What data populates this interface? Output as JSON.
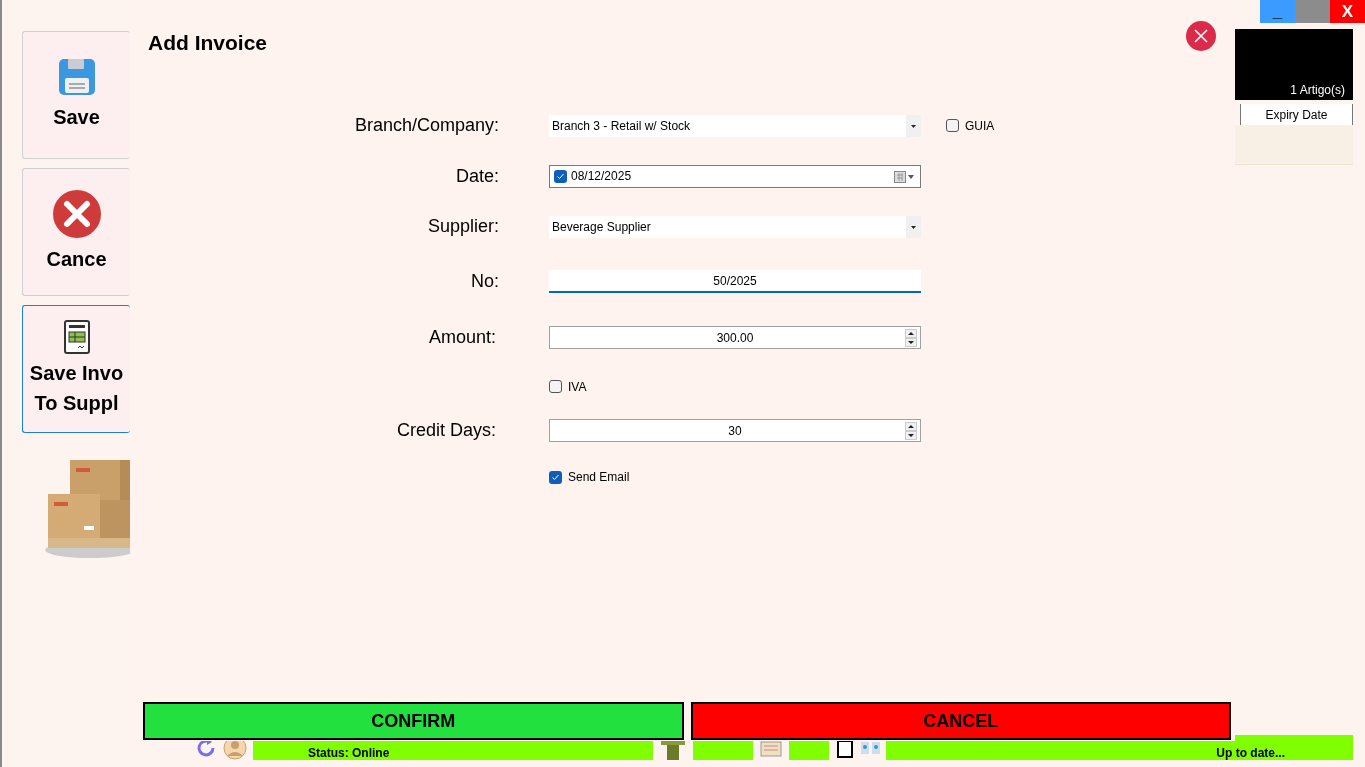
{
  "window_controls": [
    {
      "kind": "minimize",
      "label": "_"
    },
    {
      "kind": "maximize"
    },
    {
      "kind": "close",
      "label": "X"
    }
  ],
  "sidebar": {
    "buttons": [
      {
        "kind": "save",
        "lines": [
          "Save"
        ],
        "selected": false
      },
      {
        "kind": "cancel",
        "lines": [
          "Cance"
        ],
        "selected": false
      },
      {
        "kind": "invoice",
        "lines": [
          "Save Invo",
          "To Suppl"
        ],
        "selected": true
      }
    ]
  },
  "right_panel": {
    "summary": "1 Artigo(s)",
    "table": {
      "columns": [
        "Expiry Date"
      ]
    }
  },
  "dialog": {
    "title": "Add Invoice",
    "fields": [
      {
        "kind": "dropdown",
        "label": "Branch/Company:",
        "value": "Branch 3 - Retail w/ Stock",
        "side_checkbox": {
          "label": "GUIA",
          "checked": false
        }
      },
      {
        "kind": "date",
        "label": "Date:",
        "value": "08/12/2025",
        "checked": true
      },
      {
        "kind": "dropdown",
        "label": "Supplier:",
        "value": "Beverage Supplier"
      },
      {
        "kind": "text",
        "label": "No:",
        "value": "50/2025",
        "focused": true
      },
      {
        "kind": "number",
        "label": "Amount:",
        "value": "300.00"
      },
      {
        "kind": "checkbox",
        "label": "IVA",
        "checked": false
      },
      {
        "kind": "number",
        "label": "Credit Days:",
        "value": "30"
      },
      {
        "kind": "checkbox",
        "label": "Send Email",
        "checked": true
      }
    ],
    "buttons": [
      {
        "kind": "confirm",
        "label": "CONFIRM"
      },
      {
        "kind": "cancel",
        "label": "CANCEL"
      }
    ]
  },
  "status_bar": {
    "status": "Status: Online",
    "update": "Up to date..."
  }
}
